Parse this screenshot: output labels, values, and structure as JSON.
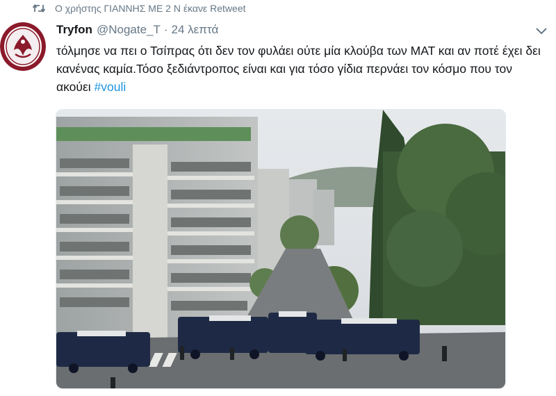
{
  "retweet": {
    "icon": "retweet-icon",
    "text": "Ο χρήστης ΓΙΑΝΝΗΣ ΜΕ 2 Ν έκανε Retweet"
  },
  "tweet": {
    "author_name": "Tryfon",
    "handle": "@Nogate_T",
    "separator": "·",
    "time": "24 λεπτά",
    "text": "τόλμησε να πει ο Τσίπρας ότι δεν τον φυλάει ούτε μία κλούβα των ΜΑΤ και αν ποτέ έχει δει κανένας καμία.Τόσο ξεδιάντροπος είναι και για τόσο γίδια περνάει τον κόσμο που τον ακούει ",
    "hashtag": "#vouli",
    "avatar_icon": "club-crest-logo",
    "menu_icon": "chevron-down-icon"
  },
  "colors": {
    "link": "#1b95e0",
    "secondary_text": "#657786",
    "primary_text": "#14171a",
    "avatar_red": "#8b1a2b"
  }
}
